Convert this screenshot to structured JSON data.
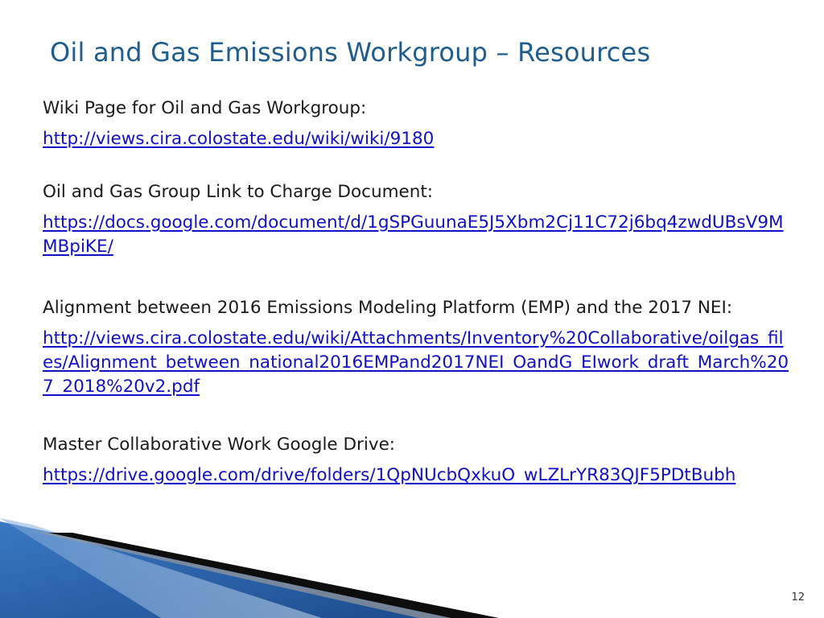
{
  "title": "Oil and Gas Emissions Workgroup – Resources",
  "resources": [
    {
      "label": "Wiki Page for Oil and Gas Workgroup:",
      "link": "http://views.cira.colostate.edu/wiki/wiki/9180"
    },
    {
      "label": "Oil and Gas Group Link to Charge Document:",
      "link": "https://docs.google.com/document/d/1gSPGuunaE5J5Xbm2Cj11C72j6bq4zwdUBsV9MMBpiKE/"
    },
    {
      "label": "Alignment between 2016 Emissions Modeling Platform (EMP) and the 2017 NEI:",
      "link": "http://views.cira.colostate.edu/wiki/Attachments/Inventory%20Collaborative/oilgas_files/Alignment_between_national2016EMPand2017NEI_OandG_EIwork_draft_March%207_2018%20v2.pdf"
    },
    {
      "label": "Master Collaborative Work Google Drive:",
      "link": "https://drive.google.com/drive/folders/1QpNUcbQxkuO_wLZLrYR83QJF5PDtBubh"
    }
  ],
  "page_number": "12",
  "colors": {
    "title": "#1f5d8c",
    "link": "#1010c8",
    "corner_blue": "#2f6fb8",
    "corner_dark": "#0d0d0d"
  }
}
